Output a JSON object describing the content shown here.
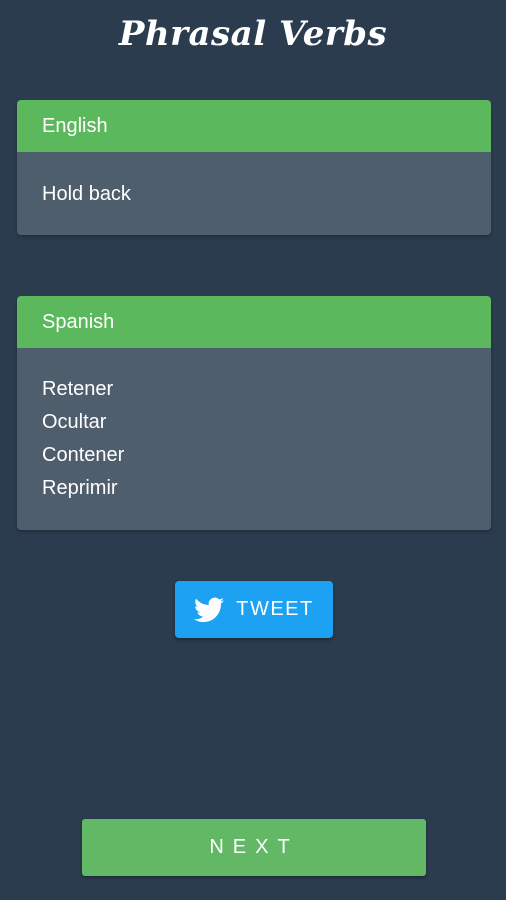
{
  "app": {
    "title": "Phrasal Verbs"
  },
  "english_card": {
    "header": "English",
    "phrase": "Hold back"
  },
  "spanish_card": {
    "header": "Spanish",
    "translations": [
      "Retener",
      "Ocultar",
      "Contener",
      "Reprimir"
    ]
  },
  "tweet_button": {
    "label": "TWEET",
    "icon": "twitter-bird-icon",
    "color": "#1da1f2"
  },
  "next_button": {
    "label": "NEXT",
    "color": "#62b864"
  },
  "colors": {
    "background": "#2b3c4e",
    "card_header": "#5cb85c",
    "card_body": "#4f5e6d"
  }
}
